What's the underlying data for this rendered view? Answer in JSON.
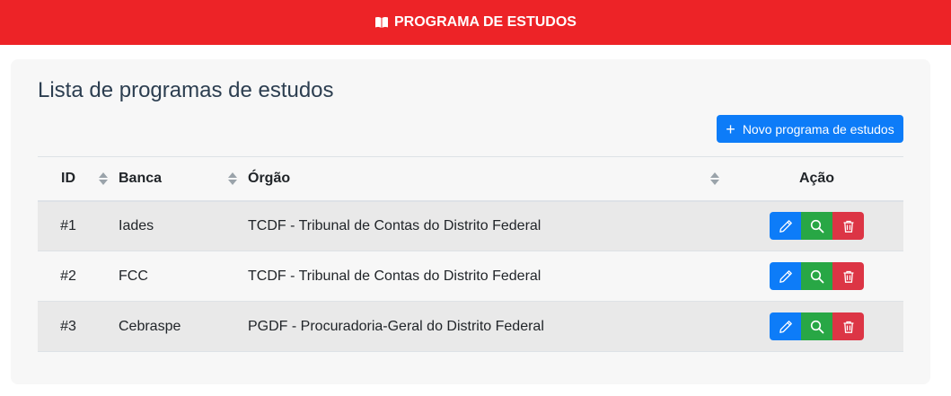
{
  "header": {
    "title": "PROGRAMA DE ESTUDOS",
    "icon": "book-icon"
  },
  "card": {
    "title": "Lista de programas de estudos"
  },
  "toolbar": {
    "new_label": "Novo programa de estudos",
    "new_icon": "plus-icon"
  },
  "table": {
    "columns": [
      "ID",
      "Banca",
      "Órgão",
      "Ação"
    ],
    "rows": [
      {
        "id": "#1",
        "banca": "Iades",
        "orgao": "TCDF - Tribunal de Contas do Distrito Federal"
      },
      {
        "id": "#2",
        "banca": "FCC",
        "orgao": "TCDF - Tribunal de Contas do Distrito Federal"
      },
      {
        "id": "#3",
        "banca": "Cebraspe",
        "orgao": "PGDF - Procuradoria-Geral do Distrito Federal"
      }
    ],
    "action_icons": [
      "pencil-icon",
      "search-icon",
      "trash-icon"
    ]
  },
  "colors": {
    "header_bg": "#ed2327",
    "primary": "#0d7cf8",
    "success": "#28a745",
    "danger": "#dc3545",
    "card_bg": "#f7f7f7"
  }
}
